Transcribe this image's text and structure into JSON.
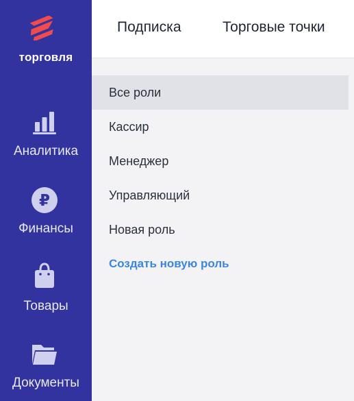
{
  "brand": {
    "name": "торговля",
    "accent_color": "#f24b4b",
    "sidebar_color": "#3333a0"
  },
  "sidebar": {
    "items": [
      {
        "label": "Аналитика",
        "icon": "bar-chart-icon"
      },
      {
        "label": "Финансы",
        "icon": "ruble-coin-icon"
      },
      {
        "label": "Товары",
        "icon": "shopping-bag-icon"
      },
      {
        "label": "Документы",
        "icon": "folder-icon"
      }
    ]
  },
  "header": {
    "tabs": [
      {
        "label": "Подписка"
      },
      {
        "label": "Торговые точки"
      }
    ]
  },
  "roles": {
    "items": [
      {
        "label": "Все роли",
        "selected": true
      },
      {
        "label": "Кассир",
        "selected": false
      },
      {
        "label": "Менеджер",
        "selected": false
      },
      {
        "label": "Управляющий",
        "selected": false
      },
      {
        "label": "Новая роль",
        "selected": false
      }
    ],
    "create_label": "Создать новую роль",
    "link_color": "#3a86e0"
  }
}
